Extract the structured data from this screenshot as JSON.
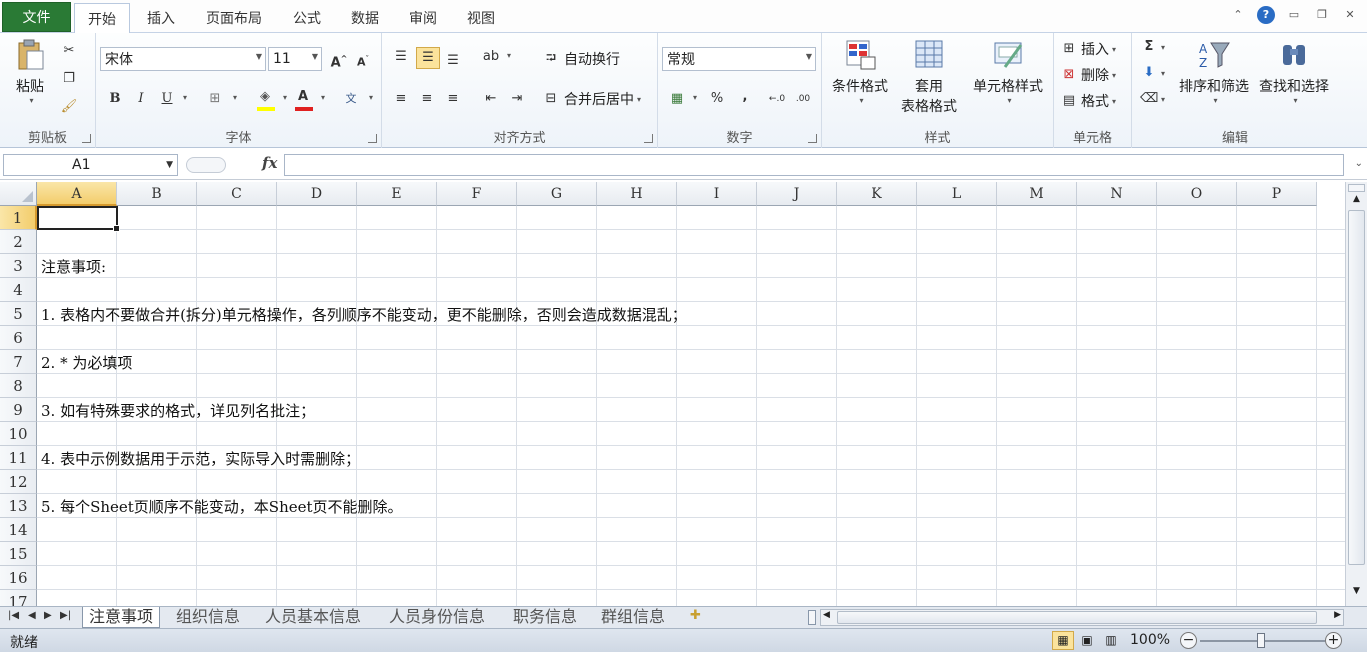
{
  "tabs": {
    "file": "文件",
    "items": [
      "开始",
      "插入",
      "页面布局",
      "公式",
      "数据",
      "审阅",
      "视图"
    ],
    "active": "开始"
  },
  "ribbon": {
    "clipboard": {
      "paste": "粘贴",
      "label": "剪贴板"
    },
    "font": {
      "name": "宋体",
      "size": "11",
      "label": "字体"
    },
    "alignment": {
      "wrap": "自动换行",
      "merge": "合并后居中",
      "label": "对齐方式"
    },
    "number": {
      "format": "常规",
      "percent": "%",
      "comma": ",",
      "label": "数字"
    },
    "styles": {
      "conditional": "条件格式",
      "table1": "套用",
      "table2": "表格格式",
      "cell": "单元格样式",
      "label": "样式"
    },
    "cells": {
      "insert": "插入",
      "delete": "删除",
      "format": "格式",
      "label": "单元格"
    },
    "editing": {
      "sum": "Σ",
      "sort": "排序和筛选",
      "find": "查找和选择",
      "label": "编辑"
    }
  },
  "formula_bar": {
    "name_box": "A1",
    "fx": "fx",
    "value": ""
  },
  "grid": {
    "columns": [
      "A",
      "B",
      "C",
      "D",
      "E",
      "F",
      "G",
      "H",
      "I",
      "J",
      "K",
      "L",
      "M",
      "N",
      "O",
      "P"
    ],
    "rows": [
      "1",
      "2",
      "3",
      "4",
      "5",
      "6",
      "7",
      "8",
      "9",
      "10",
      "11",
      "12",
      "13",
      "14",
      "15",
      "16",
      "17"
    ],
    "selected": "A1",
    "cells": {
      "A3": "注意事项:",
      "A5": "1. 表格内不要做合并(拆分)单元格操作，各列顺序不能变动，更不能删除，否则会造成数据混乱；",
      "A7": "2. * 为必填项",
      "A9": "3. 如有特殊要求的格式，详见列名批注；",
      "A11": "4. 表中示例数据用于示范，实际导入时需删除；",
      "A13": "5. 每个Sheet页顺序不能变动，本Sheet页不能删除。"
    }
  },
  "sheets": [
    "注意事项",
    "组织信息",
    "人员基本信息",
    "人员身份信息",
    "职务信息",
    "群组信息"
  ],
  "active_sheet": "注意事项",
  "status": {
    "text": "就绪",
    "zoom": "100%"
  },
  "colors": {
    "file_tab": "#2a7a35",
    "selection": "#f3cd6c",
    "highlight_fill": "#ffff00",
    "font_color": "#e02020"
  }
}
